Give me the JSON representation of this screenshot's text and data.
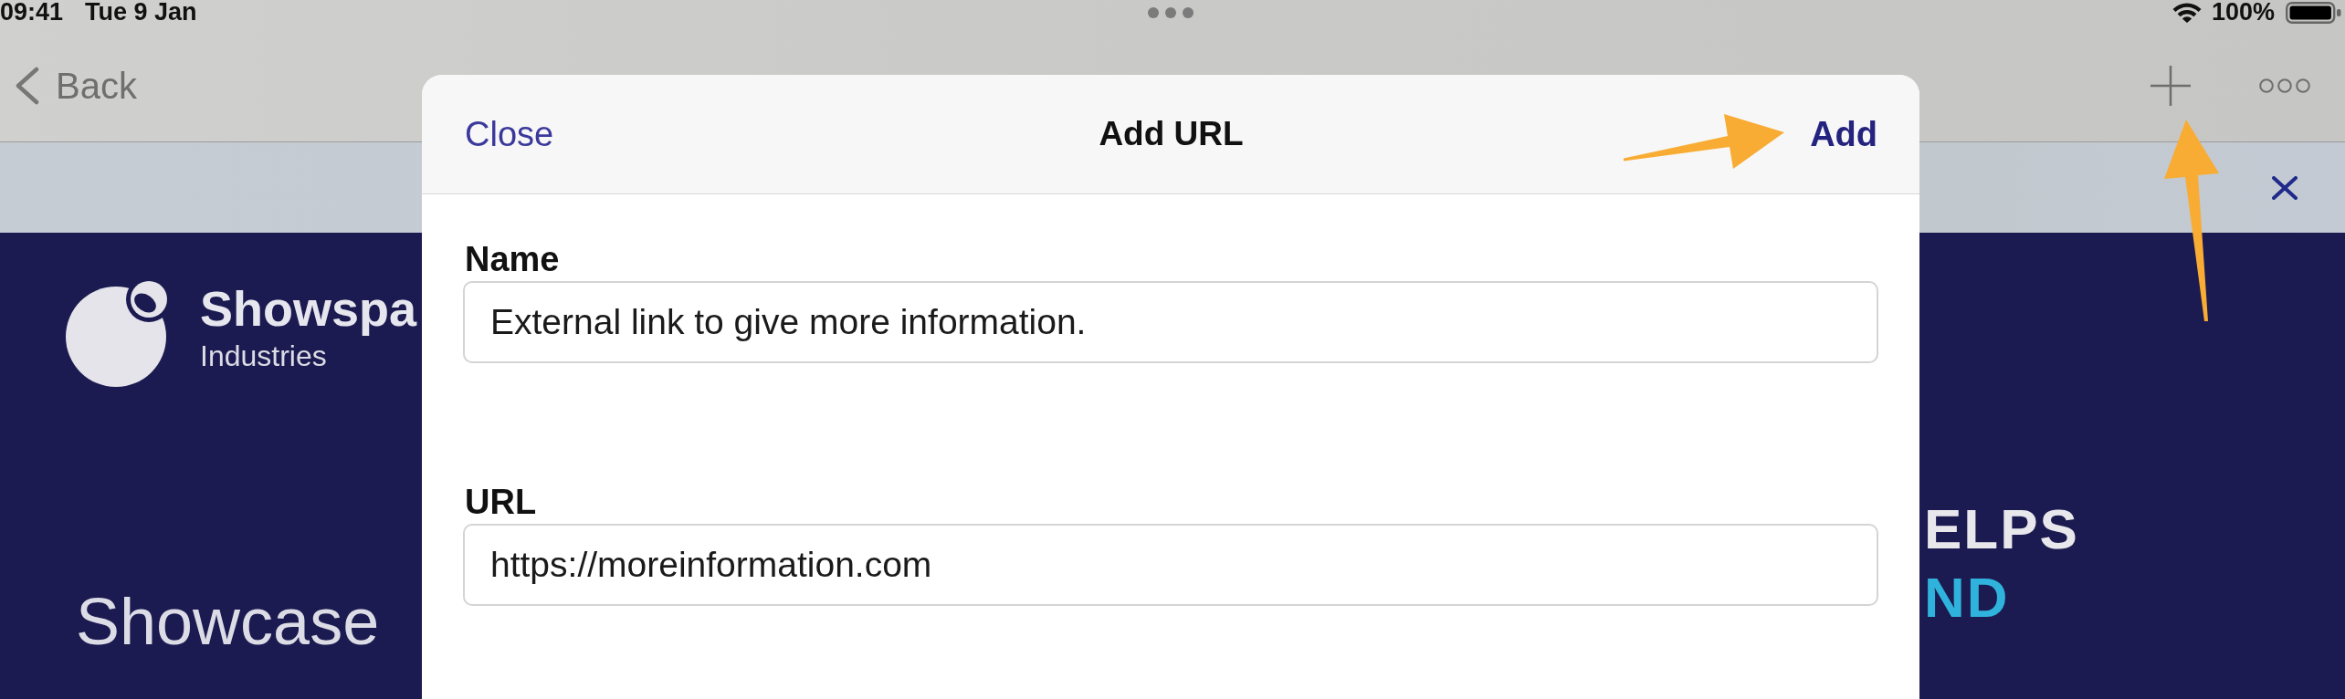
{
  "status_bar": {
    "time": "09:41",
    "date": "Tue 9 Jan",
    "battery": "100%"
  },
  "nav_bar": {
    "back": "Back"
  },
  "page": {
    "brand": {
      "name": "Showspa",
      "subtitle": "Industries"
    },
    "headline": "Showcase",
    "tagline": [
      {
        "text": "ELPS",
        "kind": "plain"
      },
      {
        "text": "ND",
        "kind": "accent"
      }
    ]
  },
  "modal": {
    "close": "Close",
    "title": "Add URL",
    "action": "Add",
    "fields": [
      {
        "label": "Name",
        "value": "External link to give more information."
      },
      {
        "label": "URL",
        "value": "https://moreinformation.com"
      }
    ]
  }
}
